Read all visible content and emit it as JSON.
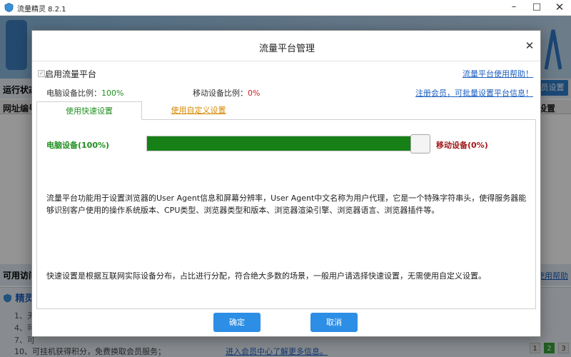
{
  "window": {
    "title": "流量精灵 8.2.1",
    "minimize": "–",
    "maximize": "□",
    "close": "✕"
  },
  "background": {
    "status_label": "运行状态",
    "vip_button": "员设置",
    "col_url": "网址编号",
    "col_settings": "设置",
    "available_label": "可用访问",
    "help_link": "使用帮助",
    "panel_title": "精灵",
    "tips": [
      "1、无",
      "4、可",
      "7、可"
    ],
    "tip_last": "10、可挂机获得积分，免费换取会员服务；",
    "vip_center_link": "进入会员中心了解更多信息。",
    "pager": [
      "1",
      "2",
      "3"
    ]
  },
  "dialog": {
    "title": "流量平台管理",
    "close": "✕",
    "enable_label": "启用流量平台",
    "enable_checked": true,
    "help_link": "流量平台使用帮助！",
    "pc_ratio_label": "电脑设备比例：",
    "pc_ratio_value": "100%",
    "mobile_ratio_label": "移动设备比例：",
    "mobile_ratio_value": "0%",
    "register_link": "注册会员，可批量设置平台信息！",
    "tabs": [
      {
        "label": "使用快速设置",
        "active": true
      },
      {
        "label": "使用自定义设置",
        "active": false
      }
    ],
    "slider": {
      "pc_label": "电脑设备(100%)",
      "mobile_label": "移动设备(0%)",
      "pc_fraction": 1.0
    },
    "description1": "流量平台功能用于设置浏览器的User Agent信息和屏幕分辨率，User Agent中文名称为用户代理，它是一个特殊字符串头，使得服务器能够识别客户使用的操作系统版本、CPU类型、浏览器类型和版本、浏览器渲染引擎、浏览器语言、浏览器插件等。",
    "description2": "快速设置是根据互联网实际设备分布，占比进行分配，符合绝大多数的场景，一般用户请选择快速设置，无需使用自定义设置。",
    "ok_button": "确定",
    "cancel_button": "取消"
  },
  "colors": {
    "accent_blue": "#2d8ee6",
    "pc_green": "#168016",
    "mobile_red": "#a01818",
    "link_blue": "#1d5fbf",
    "tab_orange": "#d48a00"
  }
}
